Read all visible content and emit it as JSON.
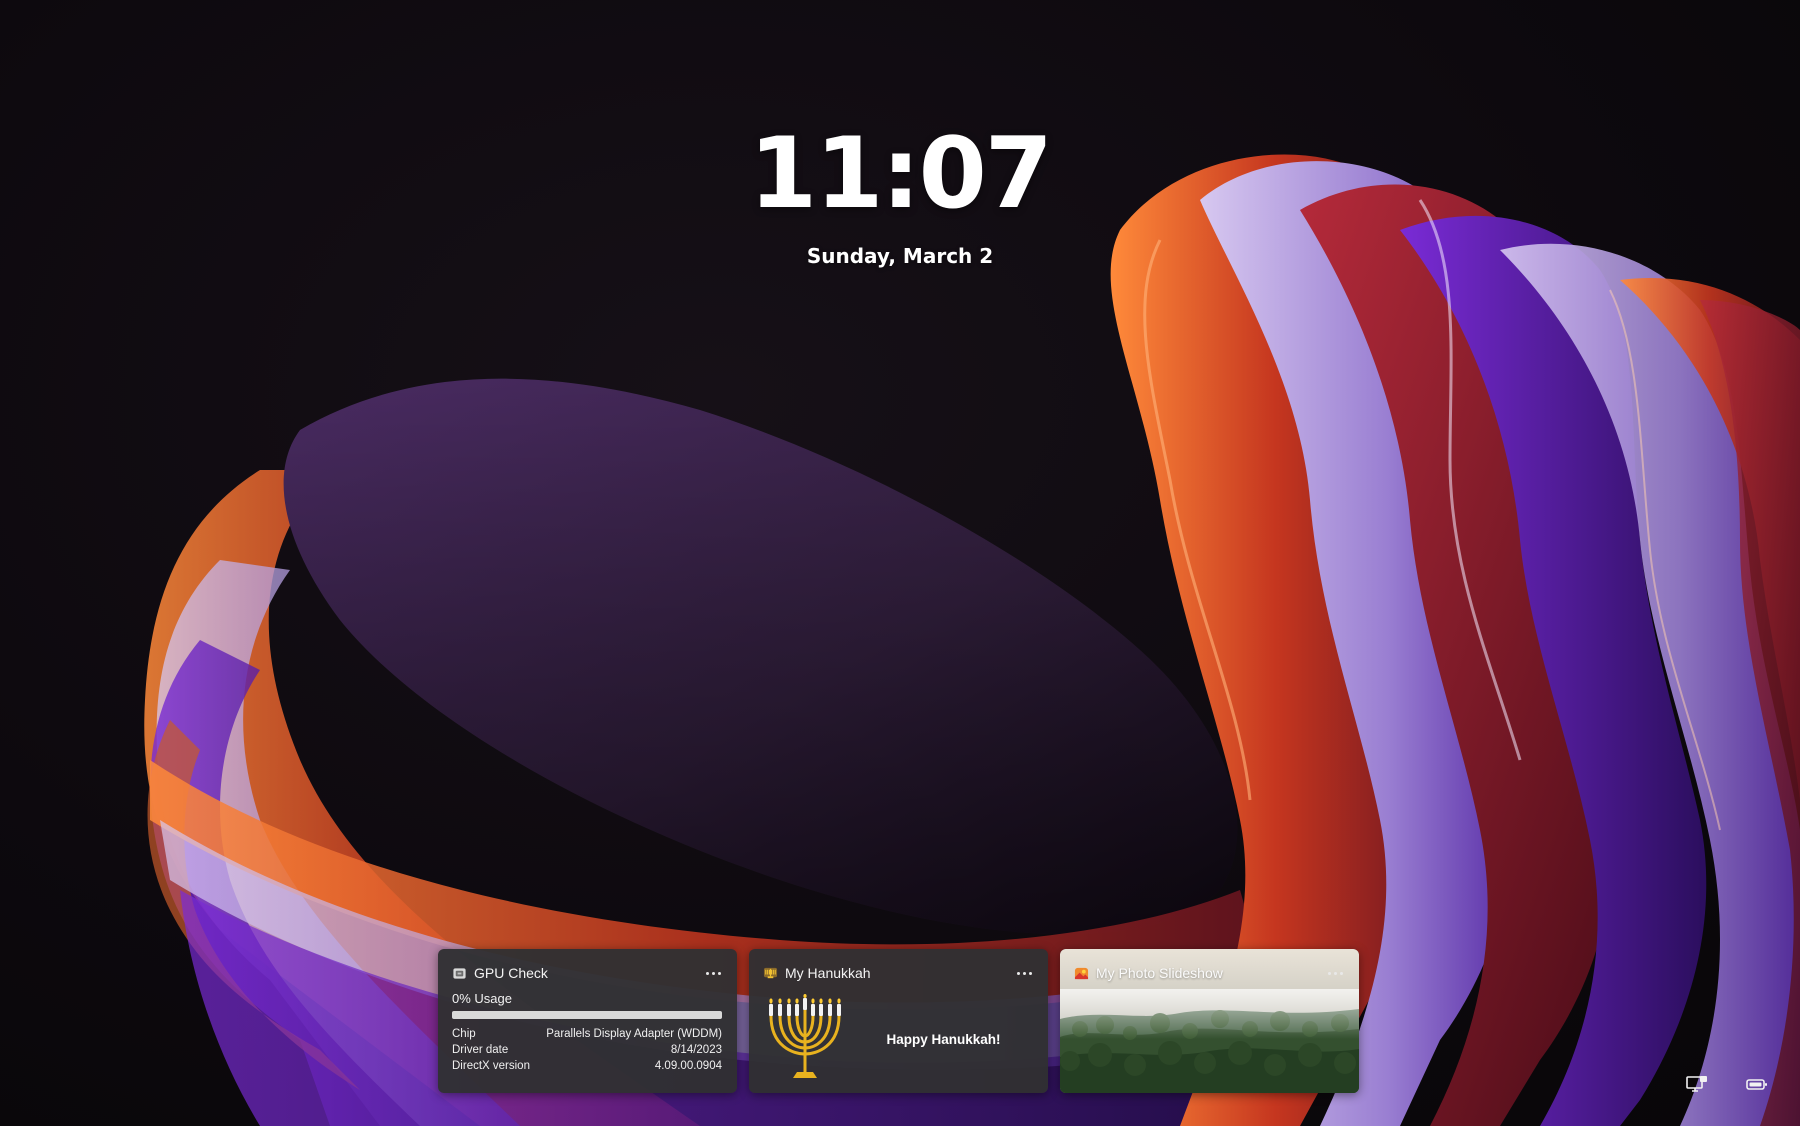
{
  "lockscreen": {
    "time": "11:07",
    "date": "Sunday, March 2"
  },
  "widgets": {
    "gpu": {
      "title": "GPU Check",
      "usage_label": "0% Usage",
      "usage_fraction": 0.0,
      "rows": [
        {
          "label": "Chip",
          "value": "Parallels Display Adapter (WDDM)"
        },
        {
          "label": "Driver date",
          "value": "8/14/2023"
        },
        {
          "label": "DirectX version",
          "value": "4.09.00.0904"
        }
      ]
    },
    "hanukkah": {
      "title": "My Hanukkah",
      "message": "Happy Hanukkah!"
    },
    "photo": {
      "title": "My Photo Slideshow"
    }
  },
  "icons": {
    "gpu_widget": "gpu-chip-icon",
    "hanukkah_widget": "menorah-icon",
    "photo_widget": "photos-icon",
    "more": "more-options-icon",
    "tray_network": "network-icon",
    "tray_battery": "battery-icon"
  },
  "colors": {
    "widget_bg": "#303032",
    "menorah_gold": "#e8b21f",
    "wallpaper_purple": "#3c2450",
    "wallpaper_orange": "#d45a1e"
  }
}
